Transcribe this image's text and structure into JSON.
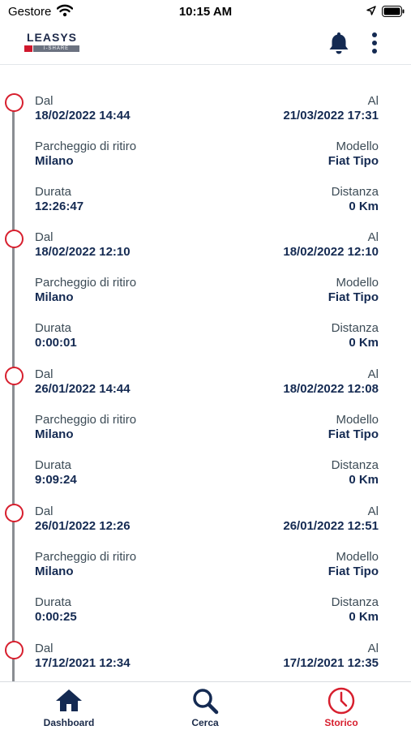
{
  "status_bar": {
    "carrier": "Gestore",
    "time": "10:15 AM"
  },
  "header": {
    "logo_text": "LEASYS",
    "logo_subtext": "I-SHARE",
    "bell_icon": "bell-icon",
    "menu_icon": "more-vertical-icon"
  },
  "colors": {
    "accent": "#d71f2e",
    "navy": "#142a52",
    "label": "#3c4b56"
  },
  "trips": [
    {
      "from_label": "Dal",
      "from_date": "18/02/2022",
      "from_time": "14:44",
      "to_label": "Al",
      "to_date": "21/03/2022",
      "to_time": "17:31",
      "pickup_label": "Parcheggio di ritiro",
      "pickup": "Milano",
      "model_label": "Modello",
      "model": "Fiat Tipo",
      "duration_label": "Durata",
      "duration": "12:26:47",
      "distance_label": "Distanza",
      "distance": "0 Km"
    },
    {
      "from_label": "Dal",
      "from_date": "18/02/2022",
      "from_time": "12:10",
      "to_label": "Al",
      "to_date": "18/02/2022",
      "to_time": "12:10",
      "pickup_label": "Parcheggio di ritiro",
      "pickup": "Milano",
      "model_label": "Modello",
      "model": "Fiat Tipo",
      "duration_label": "Durata",
      "duration": "0:00:01",
      "distance_label": "Distanza",
      "distance": "0 Km"
    },
    {
      "from_label": "Dal",
      "from_date": "26/01/2022",
      "from_time": "14:44",
      "to_label": "Al",
      "to_date": "18/02/2022",
      "to_time": "12:08",
      "pickup_label": "Parcheggio di ritiro",
      "pickup": "Milano",
      "model_label": "Modello",
      "model": "Fiat Tipo",
      "duration_label": "Durata",
      "duration": "9:09:24",
      "distance_label": "Distanza",
      "distance": "0 Km"
    },
    {
      "from_label": "Dal",
      "from_date": "26/01/2022",
      "from_time": "12:26",
      "to_label": "Al",
      "to_date": "26/01/2022",
      "to_time": "12:51",
      "pickup_label": "Parcheggio di ritiro",
      "pickup": "Milano",
      "model_label": "Modello",
      "model": "Fiat Tipo",
      "duration_label": "Durata",
      "duration": "0:00:25",
      "distance_label": "Distanza",
      "distance": "0 Km"
    },
    {
      "from_label": "Dal",
      "from_date": "17/12/2021",
      "from_time": "12:34",
      "to_label": "Al",
      "to_date": "17/12/2021",
      "to_time": "12:35"
    }
  ],
  "tab_bar": {
    "tabs": [
      {
        "label": "Dashboard",
        "icon": "home-icon"
      },
      {
        "label": "Cerca",
        "icon": "search-icon"
      },
      {
        "label": "Storico",
        "icon": "clock-icon",
        "active": true
      }
    ]
  }
}
